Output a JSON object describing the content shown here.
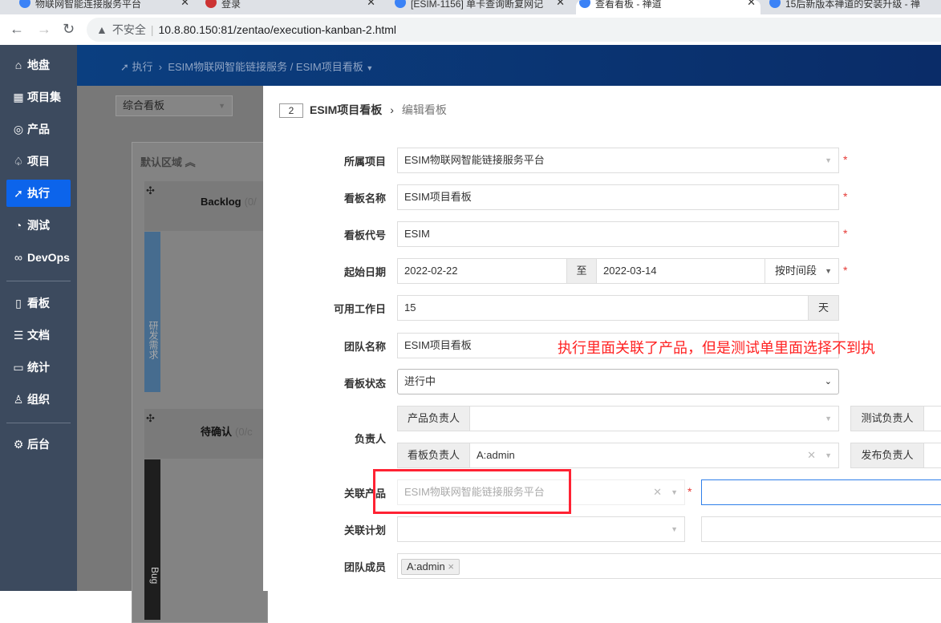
{
  "browser": {
    "tabs": [
      {
        "title": "物联网智能连接服务平台"
      },
      {
        "title": "登录"
      },
      {
        "title": "[ESIM-1156] 单卡查询断复网记"
      },
      {
        "title": "查看看板 - 禅道"
      },
      {
        "title": "15后新版本禅道的安装升级 - 禅"
      }
    ],
    "security": "不安全",
    "url": "10.8.80.150:81/zentao/execution-kanban-2.html"
  },
  "sidebar": {
    "items": [
      {
        "label": "地盘"
      },
      {
        "label": "项目集"
      },
      {
        "label": "产品"
      },
      {
        "label": "项目"
      },
      {
        "label": "执行"
      },
      {
        "label": "测试"
      },
      {
        "label": "DevOps"
      },
      {
        "label": "看板"
      },
      {
        "label": "文档"
      },
      {
        "label": "统计"
      },
      {
        "label": "组织"
      },
      {
        "label": "后台"
      }
    ]
  },
  "header": {
    "crumb1": "执行",
    "crumb2": "ESIM物联网智能链接服务 / ESIM项目看板"
  },
  "kanban": {
    "view": "综合看板",
    "region": "默认区域",
    "lanes": [
      {
        "title": "Backlog",
        "count": "(0/",
        "strip": "研发需求"
      },
      {
        "title": "待确认",
        "count": "(0/c",
        "strip": "Bug"
      }
    ]
  },
  "modal": {
    "id": "2",
    "title": "ESIM项目看板",
    "subtitle": "编辑看板",
    "fields": {
      "project": {
        "label": "所属项目",
        "value": "ESIM物联网智能链接服务平台"
      },
      "name": {
        "label": "看板名称",
        "value": "ESIM项目看板"
      },
      "code": {
        "label": "看板代号",
        "value": "ESIM"
      },
      "dates": {
        "label": "起始日期",
        "begin": "2022-02-22",
        "to": "至",
        "end": "2022-03-14",
        "mode": "按时间段"
      },
      "days": {
        "label": "可用工作日",
        "value": "15",
        "unit": "天"
      },
      "team": {
        "label": "团队名称",
        "value": "ESIM项目看板"
      },
      "status": {
        "label": "看板状态",
        "value": "进行中"
      },
      "owners": {
        "label": "负责人",
        "po": "产品负责人",
        "qd": "测试负责人",
        "pm": "看板负责人",
        "pm_value": "A:admin",
        "rd": "发布负责人"
      },
      "products": {
        "label": "关联产品",
        "value": "ESIM物联网智能链接服务平台"
      },
      "plans": {
        "label": "关联计划"
      },
      "members": {
        "label": "团队成员",
        "value": "A:admin"
      }
    },
    "annotation": "执行里面关联了产品，但是测试单里面选择不到执"
  }
}
